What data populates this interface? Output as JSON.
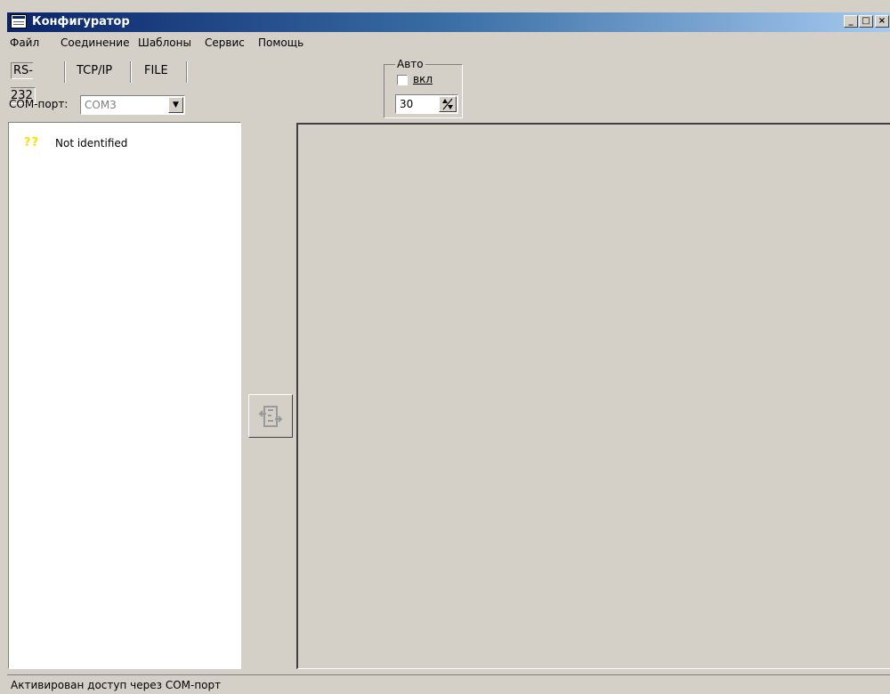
{
  "window": {
    "title": "Конфигуратор",
    "controls": {
      "minimize": "_",
      "maximize": "□",
      "close": "×"
    }
  },
  "menu": {
    "items": [
      "Файл",
      "Соединение",
      "Шаблоны",
      "Сервис",
      "Помощь"
    ]
  },
  "tabs": [
    {
      "label": "RS-232",
      "active": true
    },
    {
      "label": "TCP/IP",
      "active": false
    },
    {
      "label": "FILE",
      "active": false
    }
  ],
  "connection": {
    "port_label": "COM-порт:",
    "port_value": "COM3"
  },
  "auto": {
    "group_label": "Авто",
    "enable_label": "вкл",
    "enabled": false,
    "interval_value": "30"
  },
  "devices": [
    {
      "icon": "question-icon",
      "icon_text": "??",
      "name": "Not identified"
    }
  ],
  "status": {
    "text": "Активирован доступ через COM-порт"
  }
}
